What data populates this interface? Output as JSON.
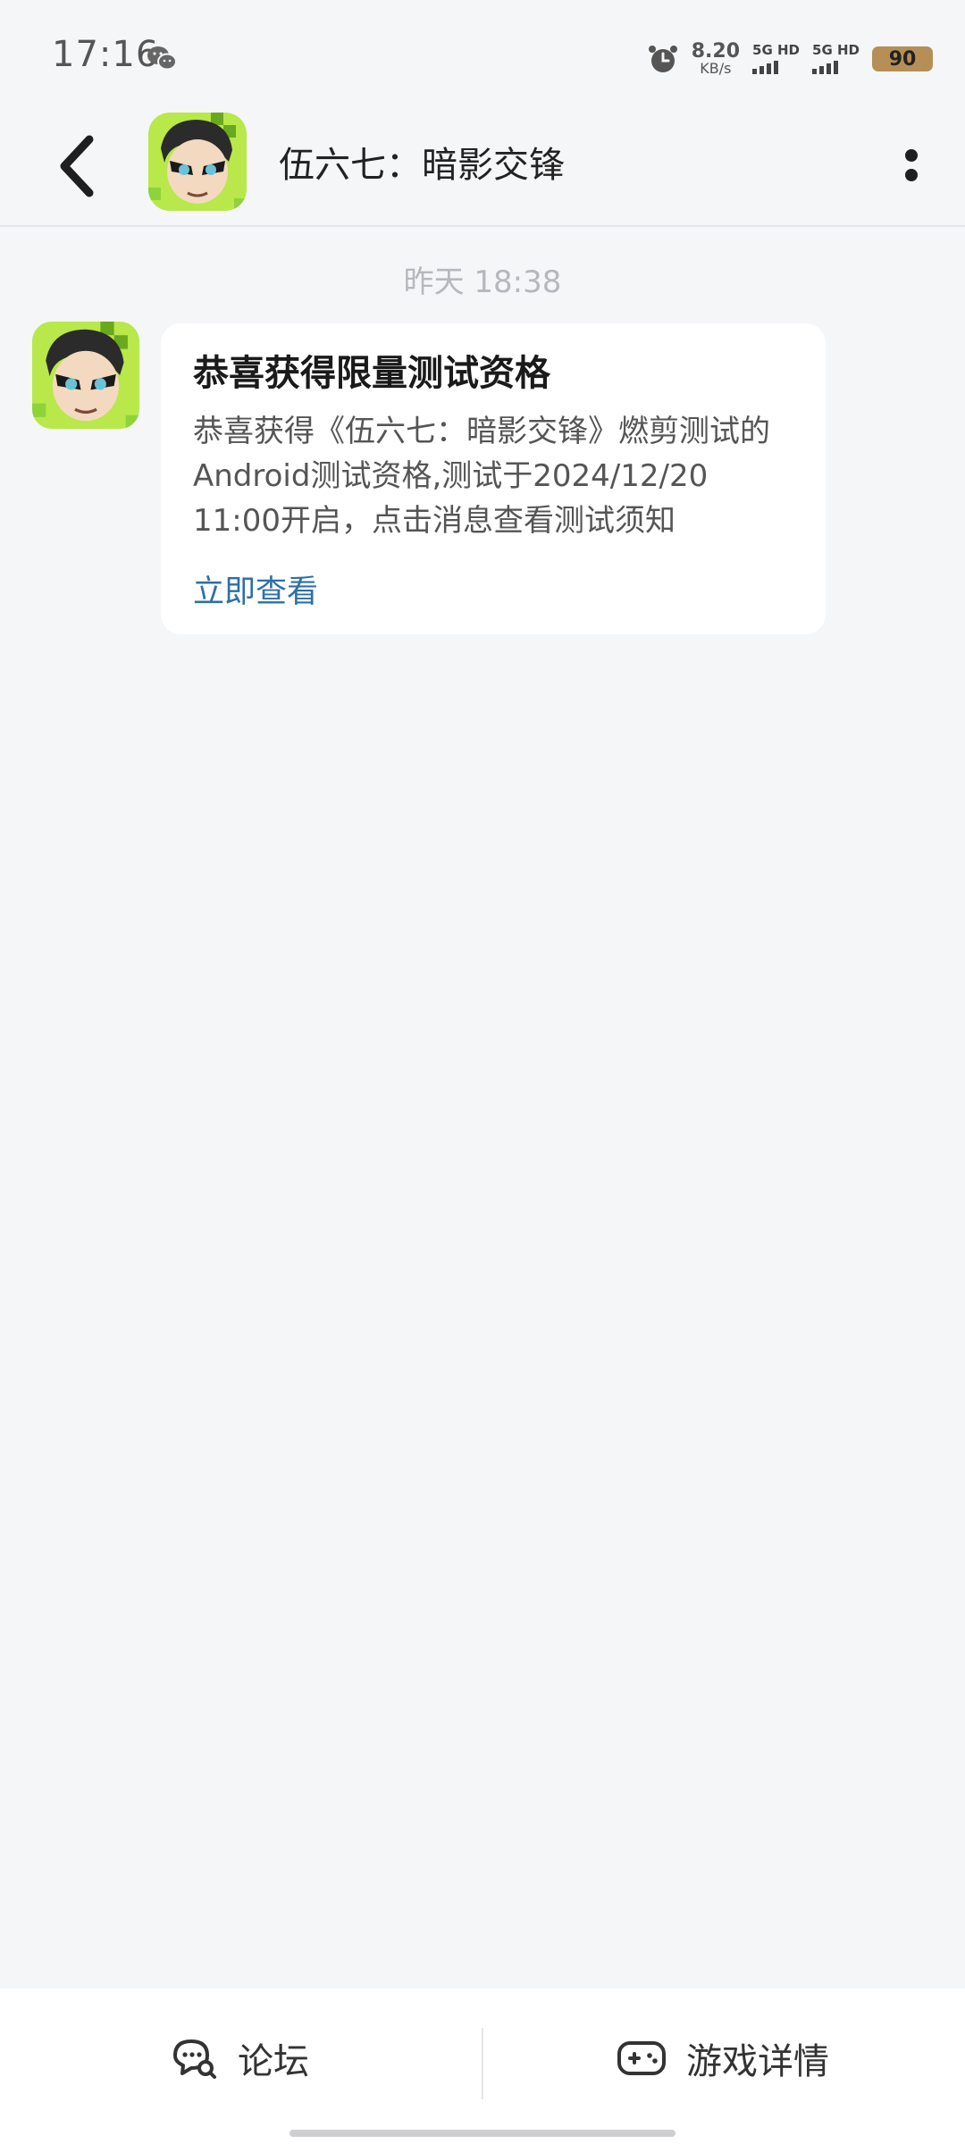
{
  "status_bar": {
    "time": "17:16",
    "net_speed_value": "8.20",
    "net_speed_unit": "KB/s",
    "sim1_label": "5G HD",
    "sim2_label": "5G HD",
    "battery": "90",
    "icons": [
      "wechat-icon",
      "alarm-icon",
      "signal-icon",
      "battery-icon"
    ]
  },
  "header": {
    "title": "伍六七：暗影交锋",
    "icons": [
      "back-arrow-icon",
      "game-avatar",
      "more-dots-icon"
    ]
  },
  "chat": {
    "timestamp": "昨天  18:38",
    "message": {
      "title": "恭喜获得限量测试资格",
      "body": "恭喜获得《伍六七：暗影交锋》燃剪测试的Android测试资格,测试于2024/12/20 11:00开启，点击消息查看测试须知",
      "link": "立即查看"
    }
  },
  "bottom_bar": {
    "forum_label": "论坛",
    "details_label": "游戏详情",
    "icons": [
      "forum-chat-icon",
      "gamepad-icon"
    ]
  },
  "colors": {
    "background": "#f5f6f8",
    "link": "#2e6fa8",
    "avatar_bg": "#b8e84a"
  }
}
